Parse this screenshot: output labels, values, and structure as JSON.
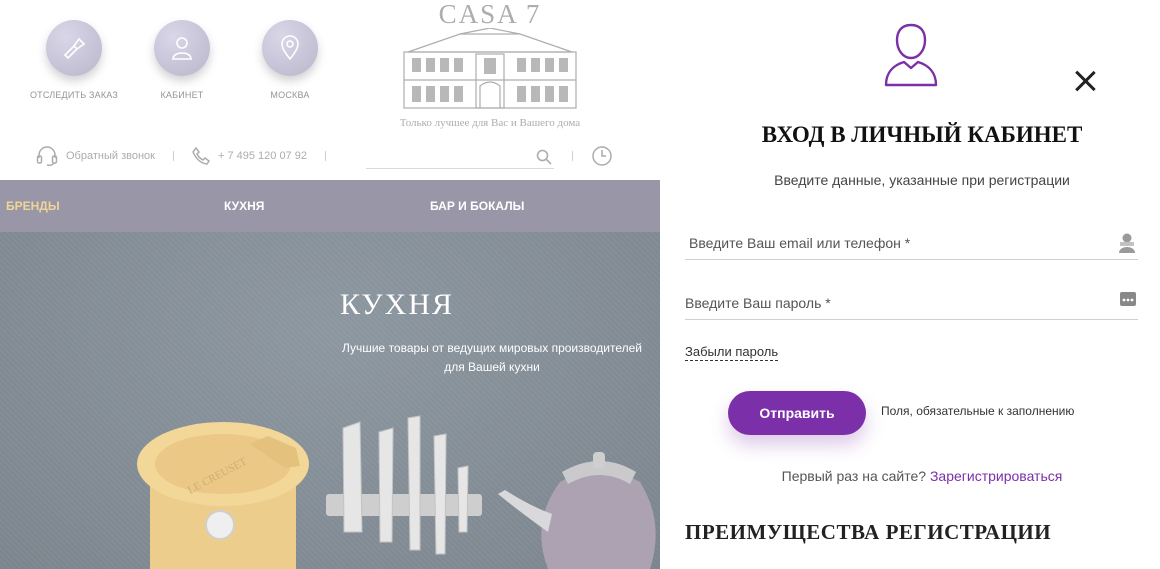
{
  "site": {
    "top_icons": [
      {
        "label": "ОТСЛЕДИТЬ ЗАКАЗ",
        "icon": "flashlight-icon"
      },
      {
        "label": "КАБИНЕТ",
        "icon": "user-icon"
      },
      {
        "label": "МОСКВА",
        "icon": "location-pin-icon"
      }
    ],
    "logo": {
      "title": "CASA 7",
      "tagline": "Только лучшее для Вас и Вашего дома"
    },
    "contacts": {
      "callback": "Обратный звонок",
      "phone": "+ 7 495 120 07 92"
    },
    "nav": [
      "БРЕНДЫ",
      "КУХНЯ",
      "БАР И БОКАЛЫ"
    ],
    "hero": {
      "title": "КУХНЯ",
      "subtitle_line1": "Лучшие товары от ведущих мировых производителей",
      "subtitle_line2": "для Вашей кухни",
      "pot_brand": "LE CREUSET"
    }
  },
  "login": {
    "title": "ВХОД В ЛИЧНЫЙ КАБИНЕТ",
    "subtitle": "Введите данные, указанные при регистрации",
    "email_placeholder": "Введите Ваш email или телефон *",
    "password_placeholder": "Введите Ваш пароль *",
    "forgot": "Забыли пароль",
    "submit": "Отправить",
    "required_note": "Поля, обязательные к заполнению",
    "first_time": "Первый раз на сайте?",
    "register": "Зарегистрироваться",
    "benefits_title": "ПРЕИМУЩЕСТВА РЕГИСТРАЦИИ"
  },
  "colors": {
    "accent": "#7b2fa8",
    "nav_bg": "#6e6b82",
    "nav_active": "#e9c46a"
  }
}
